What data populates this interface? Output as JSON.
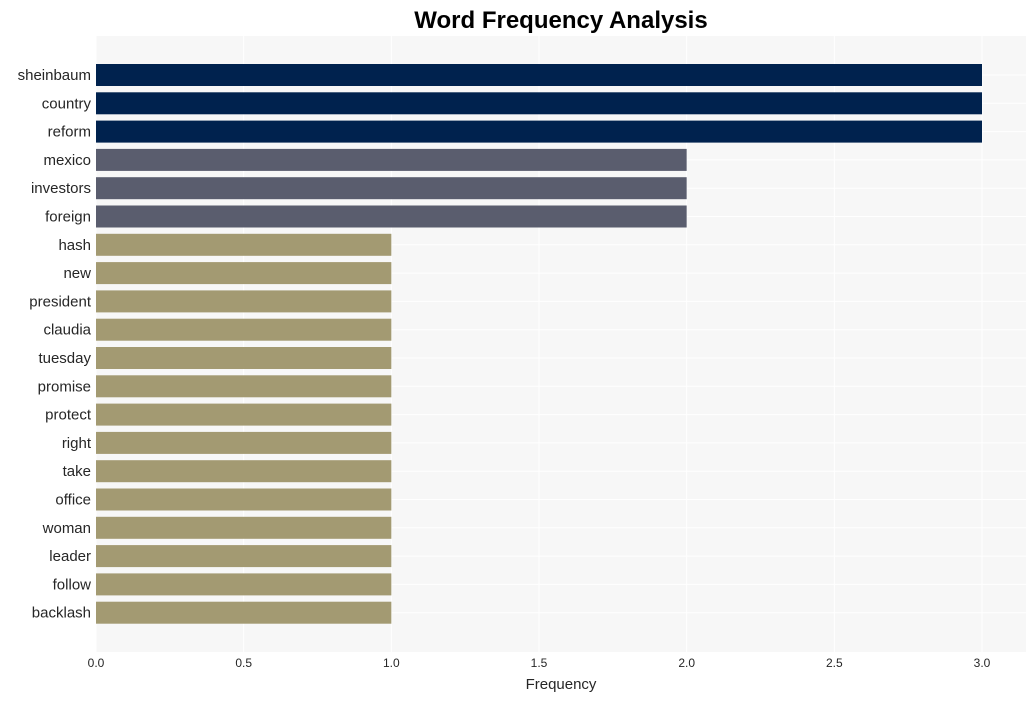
{
  "chart_data": {
    "type": "bar",
    "orientation": "horizontal",
    "title": "Word Frequency Analysis",
    "xlabel": "Frequency",
    "ylabel": "",
    "xlim": [
      0,
      3.15
    ],
    "xticks": [
      0.0,
      0.5,
      1.0,
      1.5,
      2.0,
      2.5,
      3.0
    ],
    "xtick_labels": [
      "0.0",
      "0.5",
      "1.0",
      "1.5",
      "2.0",
      "2.5",
      "3.0"
    ],
    "grid": true,
    "legend": "none",
    "categories": [
      "sheinbaum",
      "country",
      "reform",
      "mexico",
      "investors",
      "foreign",
      "hash",
      "new",
      "president",
      "claudia",
      "tuesday",
      "promise",
      "protect",
      "right",
      "take",
      "office",
      "woman",
      "leader",
      "follow",
      "backlash"
    ],
    "values": [
      3,
      3,
      3,
      2,
      2,
      2,
      1,
      1,
      1,
      1,
      1,
      1,
      1,
      1,
      1,
      1,
      1,
      1,
      1,
      1
    ],
    "colors": {
      "3": "#00224e",
      "2": "#5a5d6e",
      "1": "#a39a72"
    },
    "background": "#f7f7f7",
    "gridline_color": "#ffffff"
  }
}
